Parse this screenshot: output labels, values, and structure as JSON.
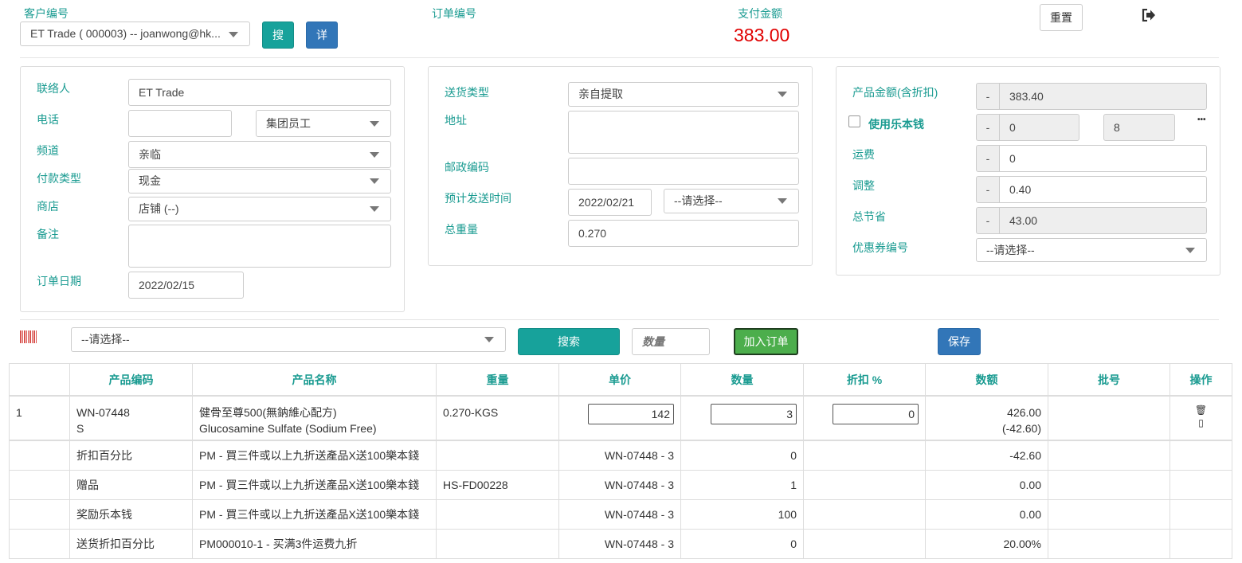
{
  "header": {
    "customer_label": "客户编号",
    "customer_value": "ET Trade ( 000003) -- joanwong@hk...",
    "search_btn": "搜",
    "detail_btn": "详",
    "order_no_label": "订单编号",
    "pay_amount_label": "支付金额",
    "pay_amount_value": "383.00",
    "reset_btn": "重置"
  },
  "left": {
    "contact_label": "联络人",
    "contact_value": "ET Trade",
    "phone_label": "电话",
    "phone_value": "",
    "phone_type": "集团员工",
    "channel_label": "频道",
    "channel_value": "亲临",
    "pay_type_label": "付款类型",
    "pay_type_value": "现金",
    "shop_label": "商店",
    "shop_value": "店铺 (--)",
    "remark_label": "备注",
    "remark_value": "",
    "order_date_label": "订单日期",
    "order_date_value": "2022/02/15"
  },
  "middle": {
    "delivery_type_label": "送货类型",
    "delivery_type_value": "亲自提取",
    "address_label": "地址",
    "address_value": "",
    "postcode_label": "邮政编码",
    "postcode_value": "",
    "eta_label": "预计发送时间",
    "eta_date": "2022/02/21",
    "eta_time": "--请选择--",
    "weight_label": "总重量",
    "weight_value": "0.270"
  },
  "right": {
    "product_amount_label": "产品金额(含折扣)",
    "product_amount_value": "383.40",
    "use_points_label": "使用乐本钱",
    "use_points_value": "0",
    "points_balance": "8",
    "shipping_label": "运费",
    "shipping_value": "0",
    "adjust_label": "调整",
    "adjust_value": "0.40",
    "saving_label": "总节省",
    "saving_value": "43.00",
    "coupon_label": "优惠券编号",
    "coupon_value": "--请选择--",
    "addon_symbol": "-",
    "more_symbol": "•••"
  },
  "toolbar": {
    "product_select": "--请选择--",
    "search_btn": "搜索",
    "qty_placeholder": "数量",
    "add_btn": "加入订单",
    "save_btn": "保存"
  },
  "table": {
    "headers": [
      "产品编码",
      "产品名称",
      "重量",
      "单价",
      "数量",
      "折扣 %",
      "数额",
      "批号",
      "操作"
    ],
    "main_row": {
      "index": "1",
      "code_line1": "WN-07448",
      "code_line2": "S",
      "name_line1": "健骨至尊500(無鈉維心配方)",
      "name_line2": "Glucosamine Sulfate (Sodium Free)",
      "weight": "0.270-KGS",
      "price": "142",
      "qty": "3",
      "discount": "0",
      "amount": "426.00",
      "amount_discount": "(-42.60)",
      "batch": "",
      "delete_icon": "🗑",
      "extra_icon": "▯"
    },
    "sub_rows": [
      {
        "type": "折扣百分比",
        "desc": "PM - 買三件或以上九折送產品X送100樂本錢",
        "col3": "",
        "ref": "WN-07448 - 3",
        "qty": "0",
        "amount": "-42.60"
      },
      {
        "type": "赠品",
        "desc": "PM - 買三件或以上九折送產品X送100樂本錢",
        "col3": "HS-FD00228",
        "ref": "WN-07448 - 3",
        "qty": "1",
        "amount": "0.00"
      },
      {
        "type": "奖励乐本钱",
        "desc": "PM - 買三件或以上九折送產品X送100樂本錢",
        "col3": "",
        "ref": "WN-07448 - 3",
        "qty": "100",
        "amount": "0.00"
      },
      {
        "type": "送货折扣百分比",
        "desc": "PM000010-1 - 买满3件运费九折",
        "col3": "",
        "ref": "WN-07448 - 3",
        "qty": "0",
        "amount": "20.00%"
      }
    ]
  }
}
